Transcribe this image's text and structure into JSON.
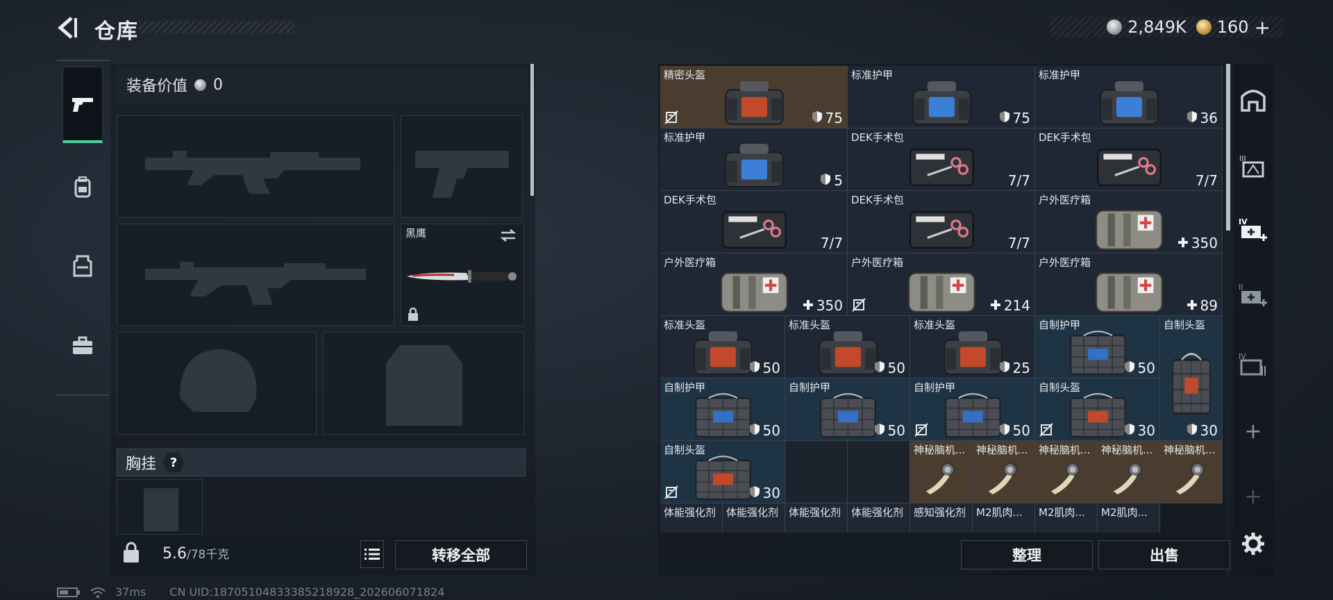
{
  "header": {
    "title": "仓库",
    "currency": {
      "silver": "2,849K",
      "gold": "160"
    }
  },
  "loadout": {
    "value_label": "装备价值",
    "value": "0",
    "knife_name": "黑鹰",
    "chest_rig_label": "胸挂",
    "chest_rig_hint": "?",
    "weight_current": "5.6",
    "weight_max": "/78千克",
    "transfer_all": "转移全部"
  },
  "stash": {
    "sort_label": "整理",
    "sell_label": "出售",
    "items": [
      {
        "name": "精密头盔",
        "value": "75",
        "icon": "shield-icon",
        "nolock": true,
        "bg": "#4a3d30",
        "art": "helmet-red"
      },
      {
        "name": "标准护甲",
        "value": "75",
        "icon": "shield-icon",
        "nolock": false,
        "bg": "#1f2634",
        "art": "armor-blue"
      },
      {
        "name": "标准护甲",
        "value": "36",
        "icon": "shield-icon",
        "nolock": false,
        "bg": "#1f2634",
        "art": "armor-blue"
      },
      {
        "name": "标准护甲",
        "value": "5",
        "icon": "shield-icon",
        "nolock": false,
        "bg": "#1f2634",
        "art": "armor-blue"
      },
      {
        "name": "DEK手术包",
        "value": "7/7",
        "icon": "",
        "nolock": false,
        "bg": "#1f2634",
        "art": "kit"
      },
      {
        "name": "DEK手术包",
        "value": "7/7",
        "icon": "",
        "nolock": false,
        "bg": "#1f2634",
        "art": "kit"
      },
      {
        "name": "DEK手术包",
        "value": "7/7",
        "icon": "",
        "nolock": false,
        "bg": "#1f2634",
        "art": "kit"
      },
      {
        "name": "DEK手术包",
        "value": "7/7",
        "icon": "",
        "nolock": false,
        "bg": "#1f2634",
        "art": "kit"
      },
      {
        "name": "户外医疗箱",
        "value": "350",
        "icon": "cross-icon",
        "nolock": false,
        "bg": "#1f2634",
        "art": "medbox"
      },
      {
        "name": "户外医疗箱",
        "value": "350",
        "icon": "cross-icon",
        "nolock": false,
        "bg": "#1f2634",
        "art": "medbox"
      },
      {
        "name": "户外医疗箱",
        "value": "214",
        "icon": "cross-icon",
        "nolock": true,
        "bg": "#1f2634",
        "art": "medbox"
      },
      {
        "name": "户外医疗箱",
        "value": "89",
        "icon": "cross-icon",
        "nolock": false,
        "bg": "#1f2634",
        "art": "medbox"
      },
      {
        "name": "标准头盔",
        "value": "50",
        "icon": "shield-icon",
        "nolock": false,
        "bg": "#1f2634",
        "art": "helmet-red"
      },
      {
        "name": "标准头盔",
        "value": "50",
        "icon": "shield-icon",
        "nolock": false,
        "bg": "#1f2634",
        "art": "helmet-red"
      },
      {
        "name": "标准头盔",
        "value": "25",
        "icon": "shield-icon",
        "nolock": false,
        "bg": "#1f2634",
        "art": "helmet-red"
      },
      {
        "name": "自制护甲",
        "value": "50",
        "icon": "shield-icon",
        "nolock": false,
        "bg": "#1e3344",
        "art": "diy-blue"
      },
      {
        "name": "自制头盔",
        "value": "30",
        "icon": "shield-icon",
        "nolock": false,
        "bg": "#1e3344",
        "art": "diy-red"
      },
      {
        "name": "自制护甲",
        "value": "50",
        "icon": "shield-icon",
        "nolock": false,
        "bg": "#1e3344",
        "art": "diy-blue"
      },
      {
        "name": "自制护甲",
        "value": "50",
        "icon": "shield-icon",
        "nolock": false,
        "bg": "#1e3344",
        "art": "diy-blue"
      },
      {
        "name": "自制护甲",
        "value": "50",
        "icon": "shield-icon",
        "nolock": true,
        "bg": "#1e3344",
        "art": "diy-blue"
      },
      {
        "name": "自制头盔",
        "value": "30",
        "icon": "shield-icon",
        "nolock": true,
        "bg": "#1e3344",
        "art": "diy-red"
      },
      {
        "name": "自制头盔",
        "value": "30",
        "icon": "shield-icon",
        "nolock": true,
        "bg": "#1e3344",
        "art": "diy-red"
      },
      {
        "name": "神秘脑机...",
        "value": "",
        "icon": "",
        "nolock": false,
        "bg": "#4a3d30",
        "art": "implant"
      },
      {
        "name": "神秘脑机...",
        "value": "",
        "icon": "",
        "nolock": false,
        "bg": "#4a3d30",
        "art": "implant"
      },
      {
        "name": "神秘脑机...",
        "value": "",
        "icon": "",
        "nolock": false,
        "bg": "#4a3d30",
        "art": "implant"
      },
      {
        "name": "神秘脑机...",
        "value": "",
        "icon": "",
        "nolock": false,
        "bg": "#4a3d30",
        "art": "implant"
      },
      {
        "name": "神秘脑机...",
        "value": "",
        "icon": "",
        "nolock": false,
        "bg": "#4a3d30",
        "art": "implant"
      },
      {
        "name": "体能强化剂",
        "value": "",
        "icon": "",
        "nolock": false,
        "bg": "#1f2634",
        "art": "syringe"
      },
      {
        "name": "体能强化剂",
        "value": "",
        "icon": "",
        "nolock": false,
        "bg": "#1f2634",
        "art": "syringe"
      },
      {
        "name": "体能强化剂",
        "value": "",
        "icon": "",
        "nolock": false,
        "bg": "#1f2634",
        "art": "syringe"
      },
      {
        "name": "体能强化剂",
        "value": "",
        "icon": "",
        "nolock": false,
        "bg": "#1f2634",
        "art": "syringe"
      },
      {
        "name": "感知强化剂",
        "value": "",
        "icon": "",
        "nolock": false,
        "bg": "#1f2634",
        "art": "syringe"
      },
      {
        "name": "M2肌肉...",
        "value": "",
        "icon": "",
        "nolock": false,
        "bg": "#1f2634",
        "art": "syringe"
      },
      {
        "name": "M2肌肉...",
        "value": "",
        "icon": "",
        "nolock": false,
        "bg": "#1f2634",
        "art": "syringe"
      },
      {
        "name": "M2肌肉...",
        "value": "",
        "icon": "",
        "nolock": false,
        "bg": "#1f2634",
        "art": "syringe"
      }
    ]
  },
  "status": {
    "ping": "37ms",
    "uid": "CN UID:18705104833385218928_202606071824"
  },
  "colors": {
    "accent": "#4ad1a0",
    "rare_bg": "#4a3d30",
    "common_bg": "#1f2634",
    "diy_bg": "#1e3344"
  }
}
